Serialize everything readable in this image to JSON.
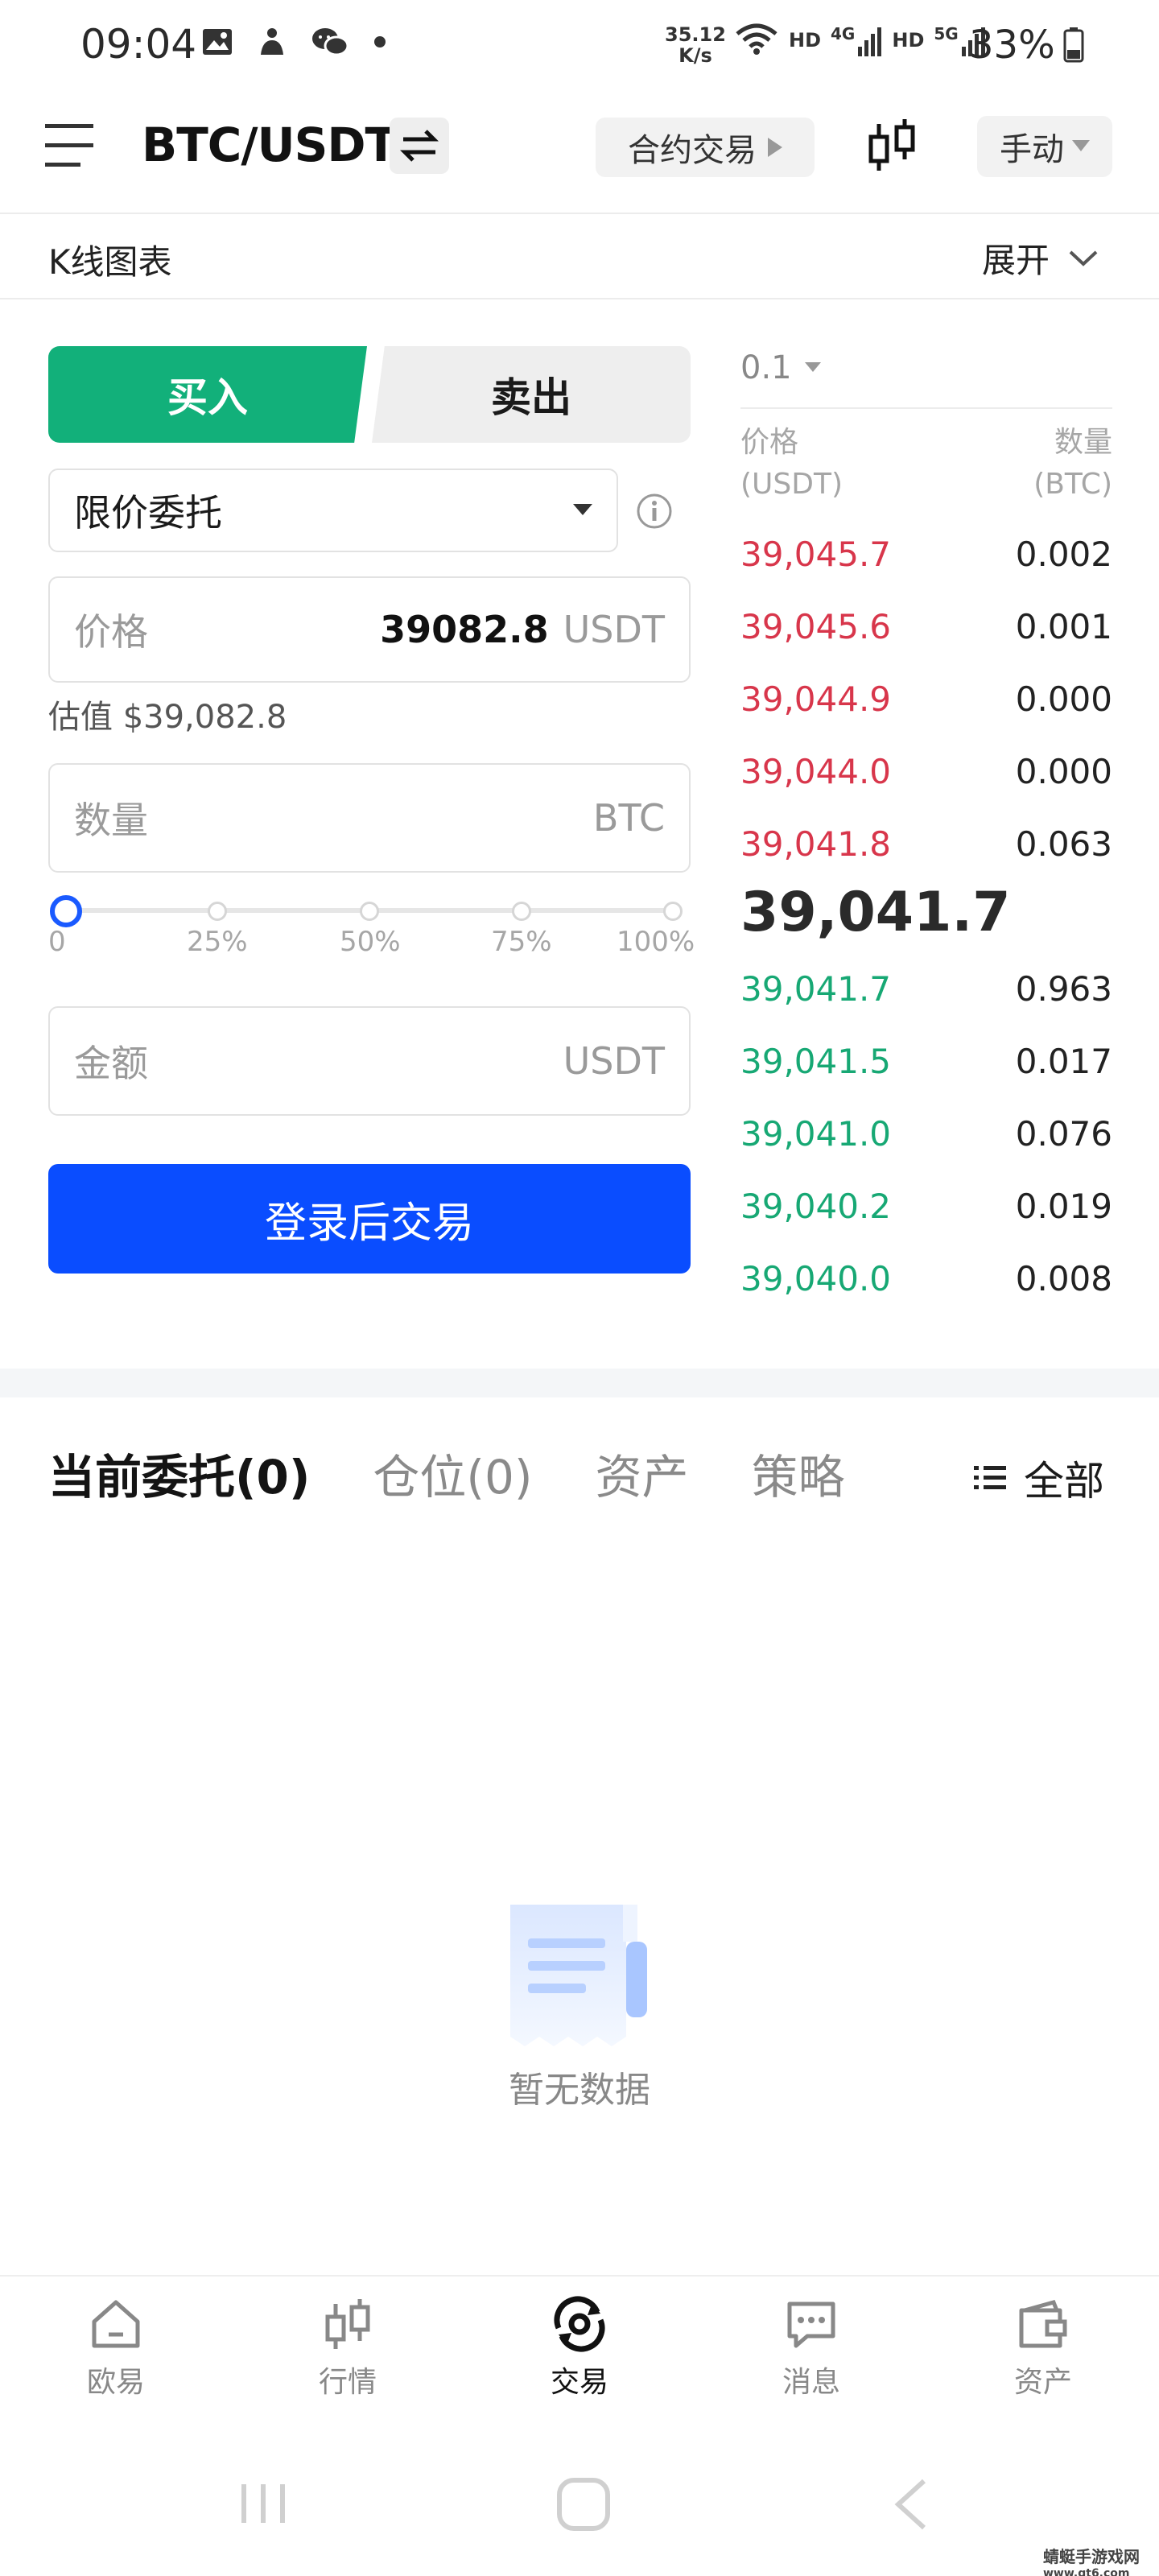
{
  "status_bar": {
    "time": "09:04",
    "net_speed_value": "35.12",
    "net_speed_unit": "K/s",
    "hd_1": "HD",
    "net_1": "4G",
    "hd_2": "HD",
    "net_2": "5G",
    "battery": "33%"
  },
  "header": {
    "pair": "BTC/USDT",
    "contract_label": "合约交易",
    "mode_label": "手动"
  },
  "kline": {
    "label": "K线图表",
    "expand_label": "展开"
  },
  "trade_form": {
    "buy_label": "买入",
    "sell_label": "卖出",
    "order_type": "限价委托",
    "price_placeholder": "价格",
    "price_value": "39082.8",
    "price_unit": "USDT",
    "estimate": "估值 $39,082.8",
    "qty_placeholder": "数量",
    "qty_unit": "BTC",
    "slider_marks": [
      "0",
      "25%",
      "50%",
      "75%",
      "100%"
    ],
    "slider_value_percent": 0,
    "amount_placeholder": "金额",
    "amount_unit": "USDT",
    "submit_label": "登录后交易"
  },
  "order_book": {
    "depth": "0.1",
    "price_header_line1": "价格",
    "price_header_line2": "(USDT)",
    "qty_header_line1": "数量",
    "qty_header_line2": "(BTC)",
    "asks": [
      {
        "price": "39,045.7",
        "qty": "0.002"
      },
      {
        "price": "39,045.6",
        "qty": "0.001"
      },
      {
        "price": "39,044.9",
        "qty": "0.000"
      },
      {
        "price": "39,044.0",
        "qty": "0.000"
      },
      {
        "price": "39,041.8",
        "qty": "0.063"
      }
    ],
    "last_price": "39,041.7",
    "bids": [
      {
        "price": "39,041.7",
        "qty": "0.963"
      },
      {
        "price": "39,041.5",
        "qty": "0.017"
      },
      {
        "price": "39,041.0",
        "qty": "0.076"
      },
      {
        "price": "39,040.2",
        "qty": "0.019"
      },
      {
        "price": "39,040.0",
        "qty": "0.008"
      }
    ],
    "ask_color": "#d8364b",
    "bid_color": "#17a874"
  },
  "orders": {
    "tabs": [
      "当前委托(0)",
      "仓位(0)",
      "资产",
      "策略"
    ],
    "filter_label": "全部",
    "empty_text": "暂无数据"
  },
  "nav": {
    "items": [
      {
        "label": "欧易",
        "icon": "home-icon"
      },
      {
        "label": "行情",
        "icon": "market-icon"
      },
      {
        "label": "交易",
        "icon": "trade-icon"
      },
      {
        "label": "消息",
        "icon": "message-icon"
      },
      {
        "label": "资产",
        "icon": "wallet-icon"
      }
    ],
    "active_index": 2
  },
  "watermark": {
    "line1": "蜻蜓手游戏网",
    "line2": "www.qt6.com"
  },
  "colors": {
    "buy_green": "#12b07a",
    "primary_blue": "#0a4dff"
  }
}
